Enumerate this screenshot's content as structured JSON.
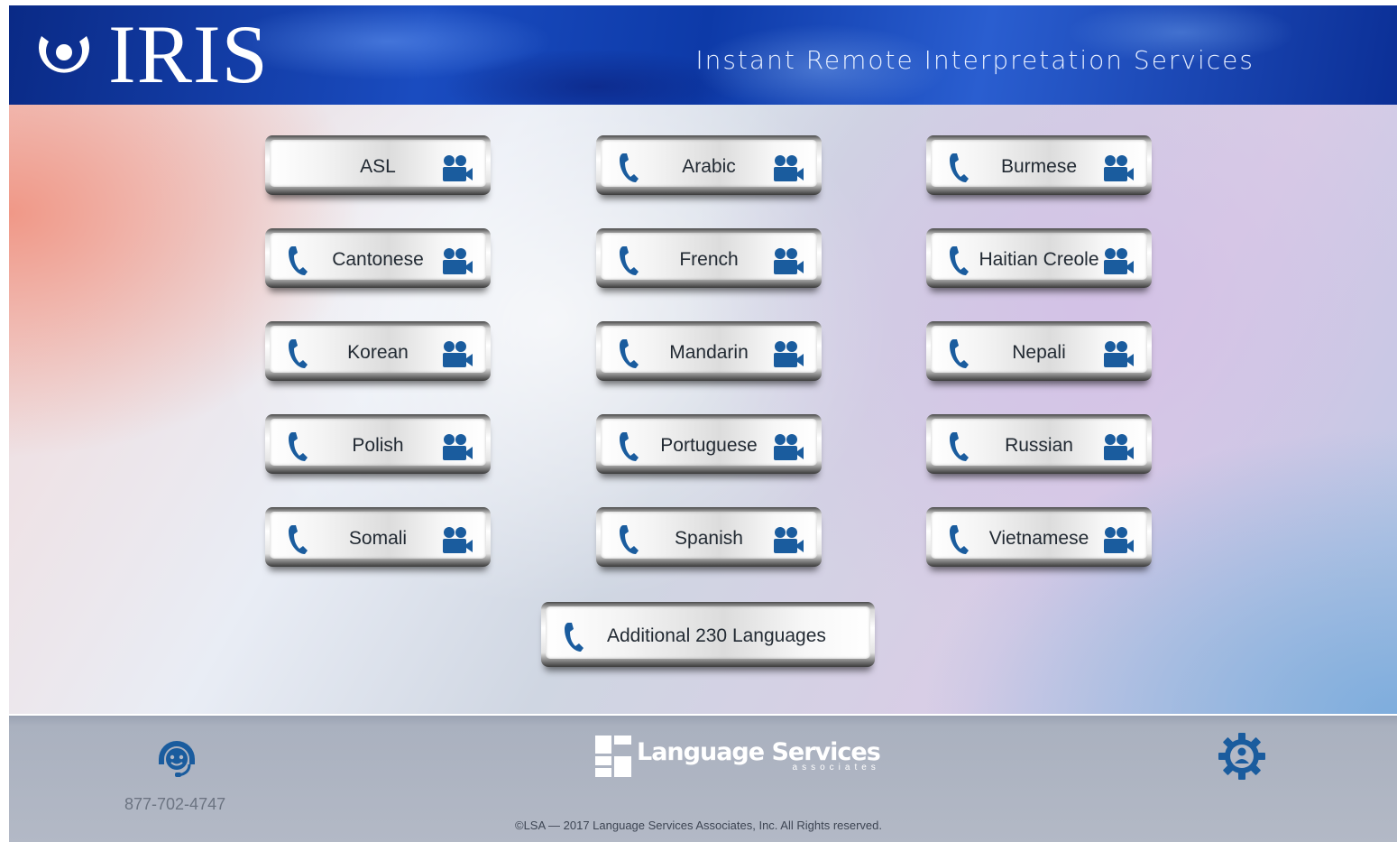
{
  "header": {
    "logo_text": "IRIS",
    "tagline": "Instant Remote Interpretation Services"
  },
  "languages": [
    {
      "label": "ASL",
      "phone": false,
      "video": true
    },
    {
      "label": "Arabic",
      "phone": true,
      "video": true
    },
    {
      "label": "Burmese",
      "phone": true,
      "video": true
    },
    {
      "label": "Cantonese",
      "phone": true,
      "video": true
    },
    {
      "label": "French",
      "phone": true,
      "video": true
    },
    {
      "label": "Haitian Creole",
      "phone": true,
      "video": true
    },
    {
      "label": "Korean",
      "phone": true,
      "video": true
    },
    {
      "label": "Mandarin",
      "phone": true,
      "video": true
    },
    {
      "label": "Nepali",
      "phone": true,
      "video": true
    },
    {
      "label": "Polish",
      "phone": true,
      "video": true
    },
    {
      "label": "Portuguese",
      "phone": true,
      "video": true
    },
    {
      "label": "Russian",
      "phone": true,
      "video": true
    },
    {
      "label": "Somali",
      "phone": true,
      "video": true
    },
    {
      "label": "Spanish",
      "phone": true,
      "video": true
    },
    {
      "label": "Vietnamese",
      "phone": true,
      "video": true
    }
  ],
  "additional": {
    "label": "Additional 230 Languages"
  },
  "footer": {
    "support_icon": "headset-support-icon",
    "phone_number": "877-702-4747",
    "brand_name": "Language Services",
    "brand_sub": "associates",
    "copyright": "©LSA — 2017 Language Services Associates, Inc. All Rights reserved.",
    "settings_icon": "gear-user-icon"
  },
  "colors": {
    "icon_blue": "#1a5c9e",
    "header_blue": "#0d3aa8"
  }
}
